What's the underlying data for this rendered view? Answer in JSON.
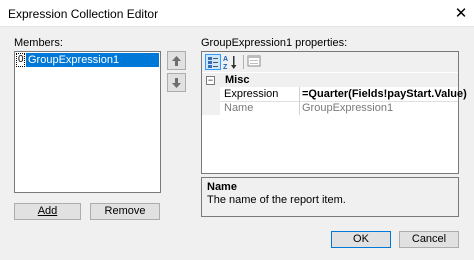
{
  "window": {
    "title": "Expression Collection Editor",
    "close_glyph": "✕"
  },
  "members": {
    "label": "Members:",
    "items": [
      {
        "index": "0",
        "name": "GroupExpression1",
        "selected": true
      }
    ],
    "add_label": "Add",
    "remove_label": "Remove"
  },
  "move_buttons": {
    "up_icon": "arrow-up-icon",
    "down_icon": "arrow-down-icon"
  },
  "properties": {
    "label": "GroupExpression1 properties:",
    "toolbar": {
      "categorized_icon": "categorized-icon",
      "alphabetical_icon": "alphabetical-icon",
      "property-pages_icon": "property-pages-icon"
    },
    "category": {
      "name": "Misc",
      "expanded_glyph": "−"
    },
    "rows": [
      {
        "name": "Expression",
        "value": "=Quarter(Fields!payStart.Value)",
        "editable": true
      },
      {
        "name": "Name",
        "value": "GroupExpression1",
        "editable": false
      }
    ],
    "description": {
      "title": "Name",
      "text": "The name of the report item."
    }
  },
  "footer": {
    "ok_label": "OK",
    "cancel_label": "Cancel"
  },
  "colors": {
    "selection": "#0078d7",
    "dialog_bg": "#f0f0f0"
  }
}
